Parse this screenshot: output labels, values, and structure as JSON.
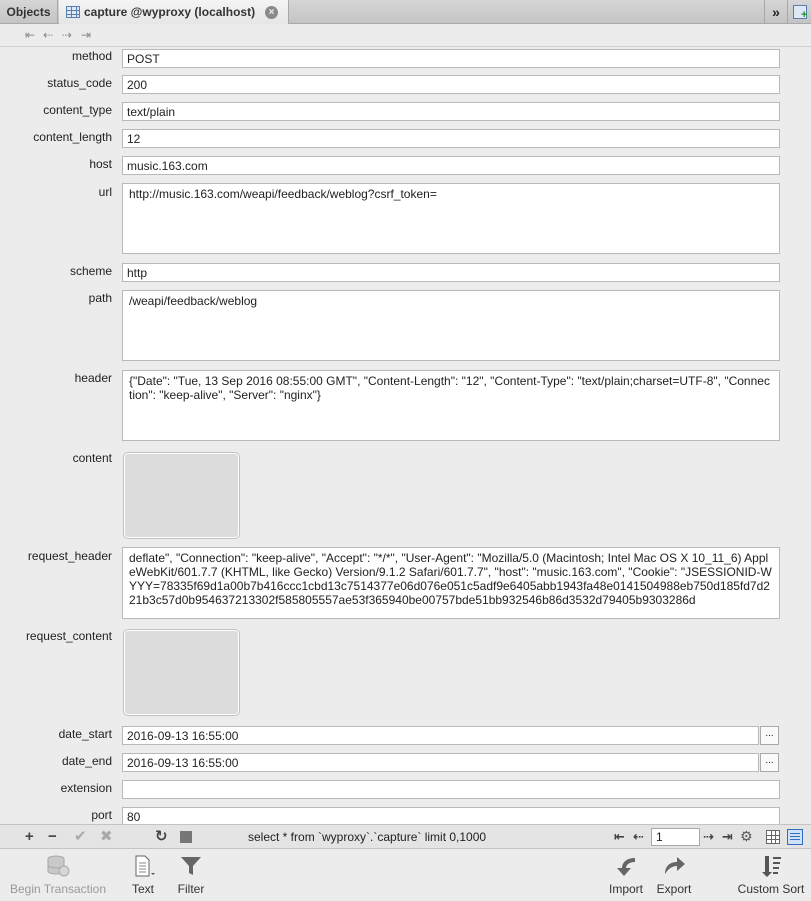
{
  "tabs": {
    "objects": "Objects",
    "active": "capture @wyproxy (localhost)"
  },
  "fields": [
    {
      "label": "method",
      "value": "POST"
    },
    {
      "label": "status_code",
      "value": "200"
    },
    {
      "label": "content_type",
      "value": "text/plain"
    },
    {
      "label": "content_length",
      "value": "12"
    },
    {
      "label": "host",
      "value": "music.163.com"
    },
    {
      "label": "url",
      "value": "http://music.163.com/weapi/feedback/weblog?csrf_token="
    },
    {
      "label": "scheme",
      "value": "http"
    },
    {
      "label": "path",
      "value": "/weapi/feedback/weblog"
    },
    {
      "label": "header",
      "value": "{\"Date\": \"Tue, 13 Sep 2016 08:55:00 GMT\", \"Content-Length\": \"12\", \"Content-Type\": \"text/plain;charset=UTF-8\", \"Connection\": \"keep-alive\", \"Server\": \"nginx\"}"
    },
    {
      "label": "content",
      "value": ""
    },
    {
      "label": "request_header",
      "value": "deflate\", \"Connection\": \"keep-alive\", \"Accept\": \"*/*\", \"User-Agent\": \"Mozilla/5.0 (Macintosh; Intel Mac OS X 10_11_6) AppleWebKit/601.7.7 (KHTML, like Gecko) Version/9.1.2 Safari/601.7.7\", \"host\": \"music.163.com\", \"Cookie\": \"JSESSIONID-WYYY=78335f69d1a00b7b416ccc1cbd13c7514377e06d076e051c5adf9e6405abb1943fa48e0141504988eb750d185fd7d221b3c57d0b954637213302f585805557ae53f365940be00757bde51bb932546b86d3532d79405b9303286d"
    },
    {
      "label": "request_content",
      "value": ""
    },
    {
      "label": "date_start",
      "value": "2016-09-13 16:55:00"
    },
    {
      "label": "date_end",
      "value": "2016-09-13 16:55:00"
    },
    {
      "label": "extension",
      "value": ""
    },
    {
      "label": "port",
      "value": "80"
    }
  ],
  "ellipsis_label": "...",
  "statusbar": {
    "sql": "select * from `wyproxy`.`capture` limit 0,1000",
    "page": "1"
  },
  "toolbar": {
    "begin_transaction": "Begin Transaction",
    "text": "Text",
    "filter": "Filter",
    "import": "Import",
    "export": "Export",
    "custom_sort": "Custom Sort"
  }
}
